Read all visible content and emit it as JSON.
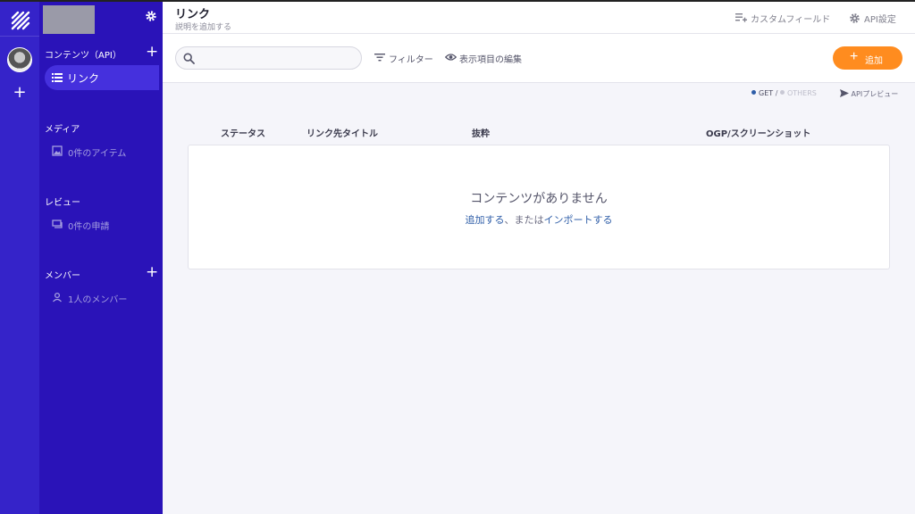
{
  "sidebar": {
    "contents_header": "コンテンツ（API）",
    "active_item": "リンク",
    "media_header": "メディア",
    "media_item": "0件のアイテム",
    "review_header": "レビュー",
    "review_item": "0件の申請",
    "members_header": "メンバー",
    "members_item": "1人のメンバー"
  },
  "header": {
    "title": "リンク",
    "subtitle": "説明を追加する",
    "custom_fields": "カスタムフィールド",
    "api_settings": "API設定"
  },
  "toolbar": {
    "search_placeholder": "",
    "filter": "フィルター",
    "edit_display": "表示項目の編集",
    "add": "追加"
  },
  "api": {
    "get": "GET",
    "slash": "/",
    "others": "OTHERS",
    "preview": "APIプレビュー"
  },
  "table": {
    "columns": [
      "ステータス",
      "リンク先タイトル",
      "抜粋",
      "OGP/スクリーンショット"
    ],
    "empty_title": "コンテンツがありません",
    "empty_add": "追加する",
    "empty_or": "、または",
    "empty_import": "インポートする"
  },
  "colors": {
    "rail": "#3523c9",
    "sidebar": "#2a13b8",
    "accent": "#ff8c1f",
    "link": "#2f5ea8"
  }
}
